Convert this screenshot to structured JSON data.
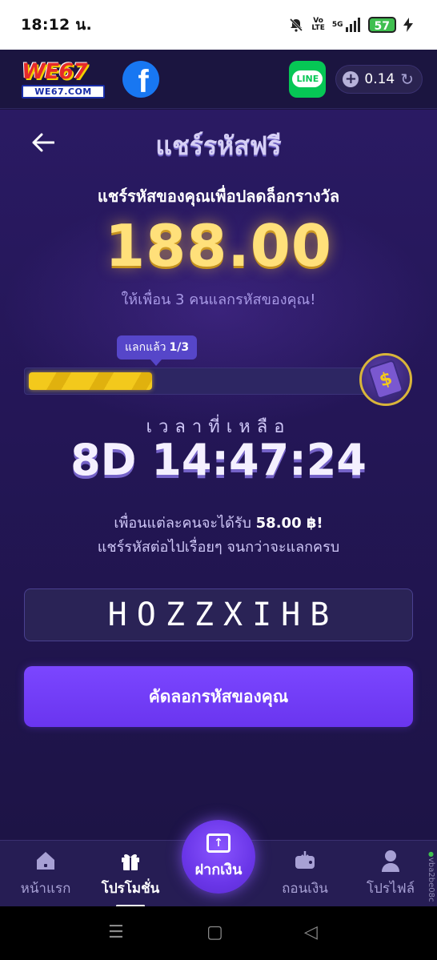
{
  "status_bar": {
    "time": "18:12 น.",
    "network_top": "Vo",
    "network_bottom": "LTE",
    "signal": "5G",
    "battery": "57"
  },
  "header": {
    "logo_main": "WE67",
    "logo_sub": "WE67.COM",
    "facebook_glyph": "f",
    "line_label": "LINE",
    "balance": "0.14"
  },
  "page": {
    "title": "แชร์รหัสฟรี",
    "subtitle": "แชร์รหัสของคุณเพื่อปลดล็อกรางวัล",
    "amount": "188.00",
    "invite_text": "ให้เพื่อน 3 คนแลกรหัสของคุณ!",
    "progress": {
      "label": "แลกแล้ว",
      "count_text": "1/3",
      "fraction": 0.333
    },
    "remaining_label": "เวลาที่เหลือ",
    "countdown": "8D 14:47:24",
    "note_line1_prefix": "เพื่อนแต่ละคนจะได้รับ",
    "note_line1_amount": "58.00 ฿!",
    "note_line2": "แชร์รหัสต่อไปเรื่อยๆ จนกว่าจะแลกครบ",
    "code": "HOZZXIHB",
    "copy_button": "คัดลอกรหัสของคุณ"
  },
  "bottom_nav": {
    "items": [
      {
        "label": "หน้าแรก",
        "icon": "home-icon"
      },
      {
        "label": "โปรโมชั่น",
        "icon": "gift-icon"
      },
      {
        "label": "ถอนเงิน",
        "icon": "wallet-icon"
      },
      {
        "label": "โปรไฟล์",
        "icon": "profile-icon"
      }
    ],
    "deposit_label": "ฝากเงิน"
  },
  "watermark": "vba2be08c",
  "colors": {
    "accent": "#6a35ef",
    "gold": "#ffe07a",
    "background": "#1d1540"
  }
}
